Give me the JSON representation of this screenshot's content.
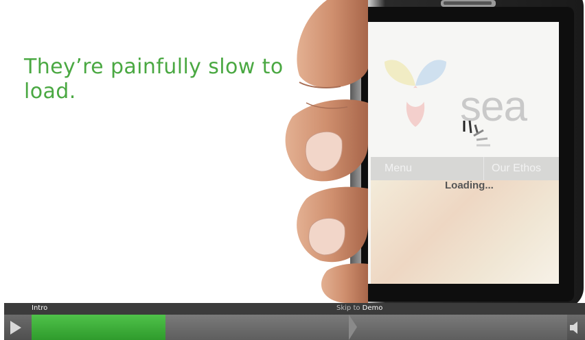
{
  "slide": {
    "headline": "They’re painfully slow to load."
  },
  "phone": {
    "brand": "sea",
    "nav": {
      "menu_label": "Menu",
      "ethos_label": "Our Ethos"
    },
    "loading_text": "Loading..."
  },
  "player": {
    "chapter_label": "Intro",
    "skip_prefix": "Skip to",
    "skip_target": "Demo",
    "progress": 0.25,
    "play_icon": "play-icon",
    "mute_icon": "speaker-mute-icon",
    "accent_color": "#3fb13a"
  }
}
